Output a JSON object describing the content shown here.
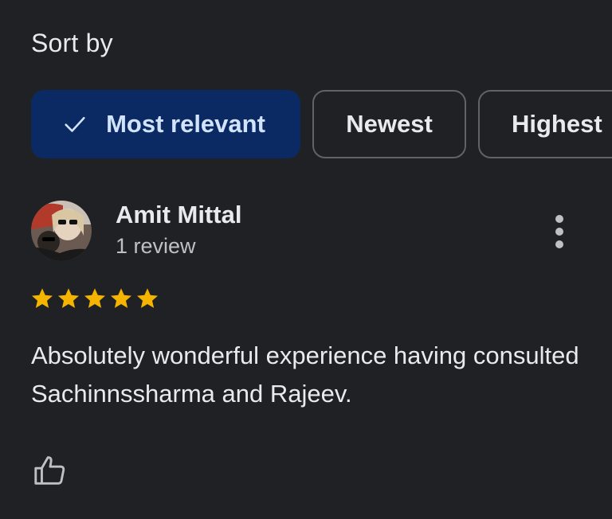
{
  "sort": {
    "label": "Sort by",
    "options": [
      {
        "label": "Most relevant",
        "selected": true
      },
      {
        "label": "Newest",
        "selected": false
      },
      {
        "label": "Highest",
        "selected": false
      }
    ]
  },
  "review": {
    "reviewer_name": "Amit Mittal",
    "review_count": "1 review",
    "rating": 5,
    "rating_max": 5,
    "text": "Absolutely wonderful experience having consulted Sachinnssharma and Rajeev."
  },
  "icons": {
    "check": "check-icon",
    "more": "more-vert-icon",
    "star": "star-icon",
    "like": "thumb-up-icon"
  },
  "colors": {
    "background": "#202124",
    "chip_selected_bg": "#0b2a63",
    "chip_selected_text": "#d2e3fc",
    "star": "#f4b400"
  }
}
